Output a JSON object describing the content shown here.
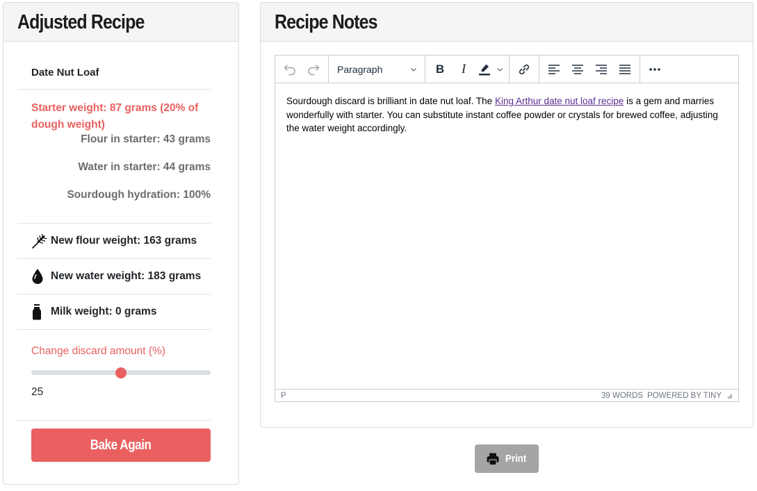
{
  "left_card": {
    "title": "Adjusted Recipe",
    "recipe_name": "Date Nut Loaf",
    "starter_weight": "Starter weight: 87 grams (20% of dough weight)",
    "flour_in_starter": "Flour in starter: 43 grams",
    "water_in_starter": "Water in starter: 44 grams",
    "sourdough_hydration": "Sourdough hydration: 100%",
    "weights": [
      {
        "icon": "wheat-icon",
        "label": "New flour weight: 163 grams"
      },
      {
        "icon": "water-drop-icon",
        "label": "New water weight: 183 grams"
      },
      {
        "icon": "milk-bottle-icon",
        "label": "Milk weight: 0 grams"
      }
    ],
    "slider": {
      "label": "Change discard amount (%)",
      "value": 25,
      "value_text": "25",
      "min": 0,
      "max": 50
    },
    "bake_again_label": "Bake Again"
  },
  "right_card": {
    "title": "Recipe Notes",
    "editor": {
      "toolbar": {
        "undo": "undo-icon",
        "redo": "redo-icon",
        "block_format": "Paragraph",
        "bold": "B",
        "italic": "I"
      },
      "content": {
        "before_link": "Sourdough discard is brilliant in date nut loaf. The ",
        "link_text": "King Arthur date nut loaf recipe",
        "after_link": " is a gem and marries wonderfully with starter. You can substitute instant coffee powder or crystals for brewed coffee, adjusting the water weight accordingly."
      },
      "statusbar": {
        "path": "P",
        "word_count": "39 WORDS",
        "branding": "POWERED BY TINY"
      }
    }
  },
  "print_label": "Print",
  "colors": {
    "accent": "#ea6060",
    "link": "#5a2d91",
    "muted_button": "#a5a5a5"
  }
}
